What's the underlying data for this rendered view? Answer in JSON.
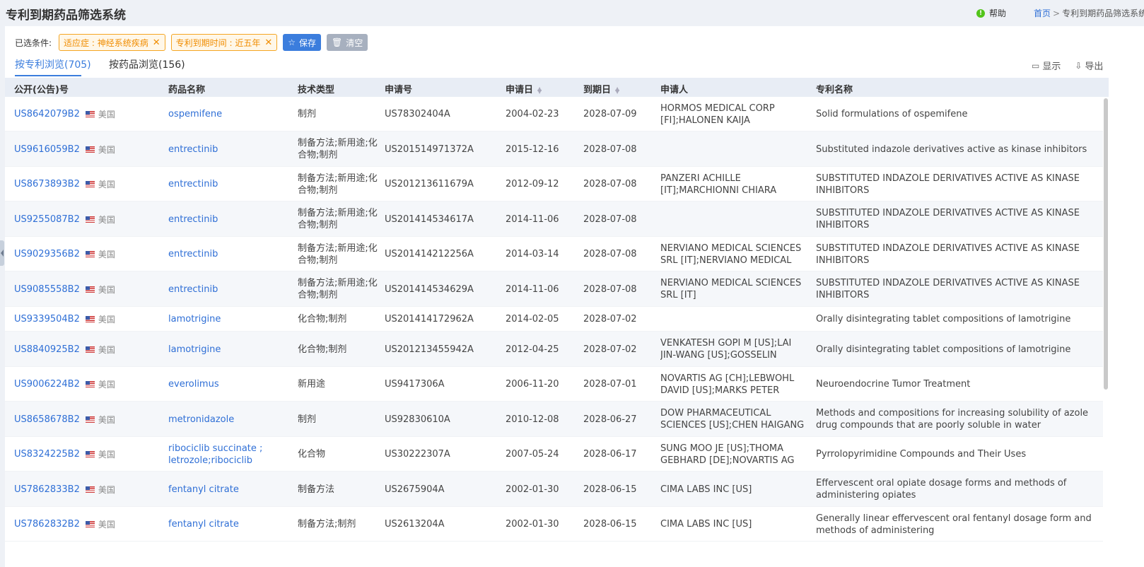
{
  "header": {
    "title": "专利到期药品筛选系统",
    "help_label": "帮助",
    "breadcrumb_home": "首页",
    "breadcrumb_sep": ">",
    "breadcrumb_current": "专利到期药品筛选系统"
  },
  "filters": {
    "label": "已选条件:",
    "chips": [
      "适应症 : 神经系统疾病",
      "专利到期时间 : 近五年"
    ],
    "save_label": "保存",
    "clear_label": "清空"
  },
  "tabs": [
    {
      "label": "按专利浏览(705)",
      "active": true
    },
    {
      "label": "按药品浏览(156)",
      "active": false
    }
  ],
  "tools": {
    "display_label": "显示",
    "export_label": "导出"
  },
  "columns": [
    "公开(公告)号",
    "药品名称",
    "技术类型",
    "申请号",
    "申请日",
    "到期日",
    "申请人",
    "专利名称"
  ],
  "rows": [
    {
      "pub": "US8642079B2",
      "country": "美国",
      "drug": "ospemifene",
      "tech": "制剂",
      "app_no": "US78302404A",
      "app_date": "2004-02-23",
      "exp_date": "2028-07-09",
      "applicant": "HORMOS MEDICAL CORP [FI];HALONEN KAIJA [FI];LEHTOLA VELI...",
      "title": "Solid formulations of ospemifene"
    },
    {
      "pub": "US9616059B2",
      "country": "美国",
      "drug": "entrectinib",
      "tech": "制备方法;新用途;化合物;制剂",
      "app_no": "US201514971372A",
      "app_date": "2015-12-16",
      "exp_date": "2028-07-08",
      "applicant": "",
      "title": "Substituted indazole derivatives active as kinase inhibitors"
    },
    {
      "pub": "US8673893B2",
      "country": "美国",
      "drug": "entrectinib",
      "tech": "制备方法;新用途;化合物;制剂",
      "app_no": "US201213611679A",
      "app_date": "2012-09-12",
      "exp_date": "2028-07-08",
      "applicant": "PANZERI ACHILLE [IT];MARCHIONNI CHIARA [IT];MENICHINCHERI...",
      "title": "SUBSTITUTED INDAZOLE DERIVATIVES ACTIVE AS KINASE INHIBITORS"
    },
    {
      "pub": "US9255087B2",
      "country": "美国",
      "drug": "entrectinib",
      "tech": "制备方法;新用途;化合物;制剂",
      "app_no": "US201414534617A",
      "app_date": "2014-11-06",
      "exp_date": "2028-07-08",
      "applicant": "",
      "title": "SUBSTITUTED INDAZOLE DERIVATIVES ACTIVE AS KINASE INHIBITORS"
    },
    {
      "pub": "US9029356B2",
      "country": "美国",
      "drug": "entrectinib",
      "tech": "制备方法;新用途;化合物;制剂",
      "app_no": "US201414212256A",
      "app_date": "2014-03-14",
      "exp_date": "2028-07-08",
      "applicant": "NERVIANO MEDICAL SCIENCES SRL [IT];NERVIANO MEDICAL SER...",
      "title": "SUBSTITUTED INDAZOLE DERIVATIVES ACTIVE AS KINASE INHIBITORS"
    },
    {
      "pub": "US9085558B2",
      "country": "美国",
      "drug": "entrectinib",
      "tech": "制备方法;新用途;化合物;制剂",
      "app_no": "US201414534629A",
      "app_date": "2014-11-06",
      "exp_date": "2028-07-08",
      "applicant": "NERVIANO MEDICAL SCIENCES SRL [IT]",
      "title": "SUBSTITUTED INDAZOLE DERIVATIVES ACTIVE AS KINASE INHIBITORS"
    },
    {
      "pub": "US9339504B2",
      "country": "美国",
      "drug": "lamotrigine",
      "tech": "化合物;制剂",
      "app_no": "US201414172962A",
      "app_date": "2014-02-05",
      "exp_date": "2028-07-02",
      "applicant": "",
      "title": "Orally disintegrating tablet compositions of lamotrigine"
    },
    {
      "pub": "US8840925B2",
      "country": "美国",
      "drug": "lamotrigine",
      "tech": "化合物;制剂",
      "app_no": "US201213455942A",
      "app_date": "2012-04-25",
      "exp_date": "2028-07-02",
      "applicant": "VENKATESH GOPI M [US];LAI JIN-WANG [US];GOSSELIN MICHAEL...",
      "title": "Orally disintegrating tablet compositions of lamotrigine"
    },
    {
      "pub": "US9006224B2",
      "country": "美国",
      "drug": "everolimus",
      "tech": "新用途",
      "app_no": "US9417306A",
      "app_date": "2006-11-20",
      "exp_date": "2028-07-01",
      "applicant": "NOVARTIS AG [CH];LEBWOHL DAVID [US];MARKS PETER WAYNE...",
      "title": "Neuroendocrine Tumor Treatment"
    },
    {
      "pub": "US8658678B2",
      "country": "美国",
      "drug": "metronidazole",
      "tech": "制剂",
      "app_no": "US92830610A",
      "app_date": "2010-12-08",
      "exp_date": "2028-06-27",
      "applicant": "DOW PHARMACEUTICAL SCIENCES [US];CHEN HAIGANG [US];YA...",
      "title": "Methods and compositions for increasing solubility of azole drug compounds that are poorly soluble in water"
    },
    {
      "pub": "US8324225B2",
      "country": "美国",
      "drug": "ribociclib succinate ; letrozole;ribociclib",
      "tech": "化合物",
      "app_no": "US30222307A",
      "app_date": "2007-05-24",
      "exp_date": "2028-06-17",
      "applicant": "SUNG MOO JE [US];THOMA GEBHARD [DE];NOVARTIS AG [CH];AS...",
      "title": "Pyrrolopyrimidine Compounds and Their Uses"
    },
    {
      "pub": "US7862833B2",
      "country": "美国",
      "drug": "fentanyl citrate",
      "tech": "制备方法",
      "app_no": "US2675904A",
      "app_date": "2002-01-30",
      "exp_date": "2028-06-15",
      "applicant": "CIMA LABS INC [US]",
      "title": "Effervescent oral opiate dosage forms and methods of administering opiates"
    },
    {
      "pub": "US7862832B2",
      "country": "美国",
      "drug": "fentanyl citrate",
      "tech": "制备方法;制剂",
      "app_no": "US2613204A",
      "app_date": "2002-01-30",
      "exp_date": "2028-06-15",
      "applicant": "CIMA LABS INC [US]",
      "title": "Generally linear effervescent oral fentanyl dosage form and methods of administering"
    }
  ]
}
